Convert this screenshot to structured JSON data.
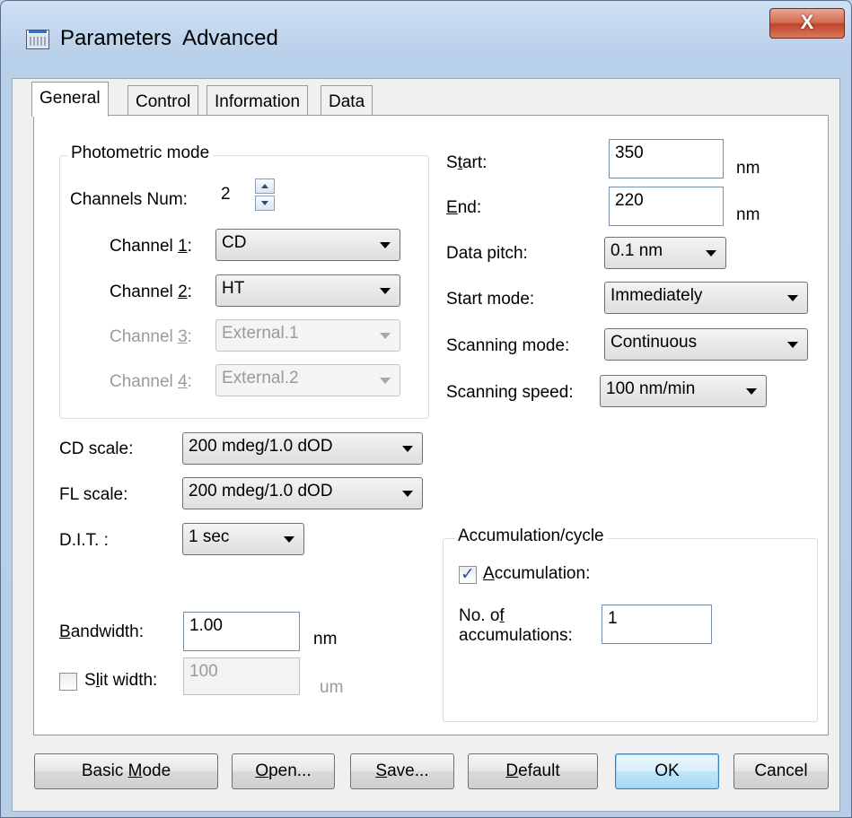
{
  "window": {
    "title": "Parameters  Advanced",
    "close_label": "X"
  },
  "tabs": [
    {
      "label": "General",
      "active": true
    },
    {
      "label": "Control",
      "active": false
    },
    {
      "label": "Information",
      "active": false
    },
    {
      "label": "Data",
      "active": false
    }
  ],
  "photometric": {
    "group_label": "Photometric mode",
    "channels_num_label": "Channels Num:",
    "channels_num_value": "2",
    "channels": [
      {
        "label_pre": "Channel ",
        "label_key": "1",
        "label_post": ":",
        "value": "CD",
        "enabled": true
      },
      {
        "label_pre": "Channel ",
        "label_key": "2",
        "label_post": ":",
        "value": "HT",
        "enabled": true
      },
      {
        "label_pre": "Channel ",
        "label_key": "3",
        "label_post": ":",
        "value": "External.1",
        "enabled": false
      },
      {
        "label_pre": "Channel ",
        "label_key": "4",
        "label_post": ":",
        "value": "External.2",
        "enabled": false
      }
    ]
  },
  "scan": {
    "start_pre": "S",
    "start_key": "t",
    "start_post": "art:",
    "start_value": "350",
    "end_key": "E",
    "end_post": "nd:",
    "end_value": "220",
    "unit_nm": "nm",
    "data_pitch_label": "Data pitch:",
    "data_pitch_value": "0.1 nm",
    "start_mode_label": "Start mode:",
    "start_mode_value": "Immediately",
    "scanning_mode_label": "Scanning mode:",
    "scanning_mode_value": "Continuous",
    "scanning_speed_label": "Scanning speed:",
    "scanning_speed_value": "100 nm/min"
  },
  "scales": {
    "cd_scale_label": "CD scale:",
    "cd_scale_value": "200 mdeg/1.0 dOD",
    "fl_scale_label": "FL scale:",
    "fl_scale_value": "200 mdeg/1.0 dOD",
    "dit_label": "D.I.T. :",
    "dit_value": "1 sec"
  },
  "bandwidth": {
    "label_key": "B",
    "label_post": "andwidth:",
    "value": "1.00",
    "unit": "nm",
    "slit_pre": "S",
    "slit_key": "l",
    "slit_post": "it width:",
    "slit_value": "100",
    "slit_unit": "um",
    "slit_checked": false
  },
  "accumulation": {
    "group_label": "Accumulation/cycle",
    "checkbox_key": "A",
    "checkbox_post": "ccumulation:",
    "checked": true,
    "count_label_1": "No. o",
    "count_label_key": "f",
    "count_label_2": "accumulations:",
    "count_value": "1"
  },
  "buttons": {
    "basic_pre": "Basic ",
    "basic_key": "M",
    "basic_post": "ode",
    "open_key": "O",
    "open_post": "pen...",
    "save_key": "S",
    "save_post": "ave...",
    "default_key": "D",
    "default_post": "efault",
    "ok": "OK",
    "cancel": "Cancel"
  }
}
